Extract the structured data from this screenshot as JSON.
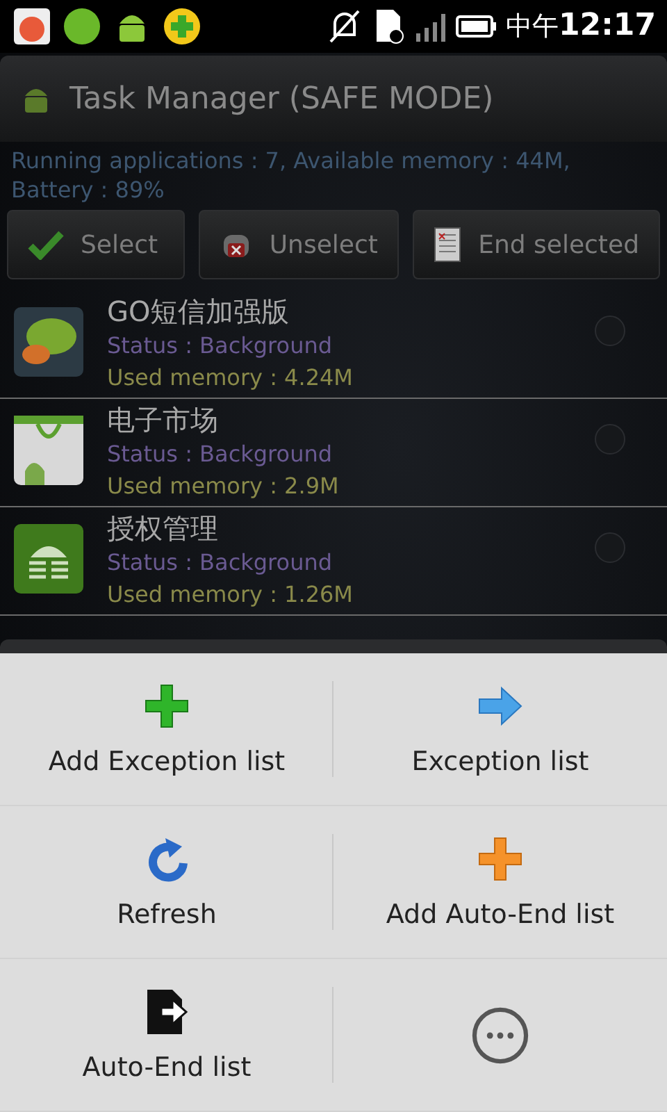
{
  "status_bar": {
    "time_prefix": "中午",
    "time": "12:17"
  },
  "window": {
    "title": "Task Manager (SAFE MODE)"
  },
  "summary": "Running applications : 7, Available memory : 44M, Battery : 89%",
  "buttons": [
    {
      "label": "Select",
      "kind": "check"
    },
    {
      "label": "Unselect",
      "kind": "unselect"
    },
    {
      "label": "End selected",
      "kind": "end"
    }
  ],
  "apps": [
    {
      "name": "GO短信加强版",
      "status": "Status : Background",
      "memory": "Used memory : 4.24M",
      "checked": false,
      "kind": "sms"
    },
    {
      "name": "电子市场",
      "status": "Status : Background",
      "memory": "Used memory : 2.9M",
      "checked": false,
      "kind": "market"
    },
    {
      "name": "授权管理",
      "status": "Status : Background",
      "memory": "Used memory : 1.26M",
      "checked": false,
      "kind": "superuser"
    }
  ],
  "menu": [
    {
      "label": "Add Exception list",
      "kind": "add-green"
    },
    {
      "label": "Exception list",
      "kind": "arrow"
    },
    {
      "label": "Refresh",
      "kind": "refresh"
    },
    {
      "label": "Add Auto-End list",
      "kind": "add-orange"
    },
    {
      "label": "Auto-End list",
      "kind": "export"
    },
    {
      "kind": "more"
    }
  ]
}
